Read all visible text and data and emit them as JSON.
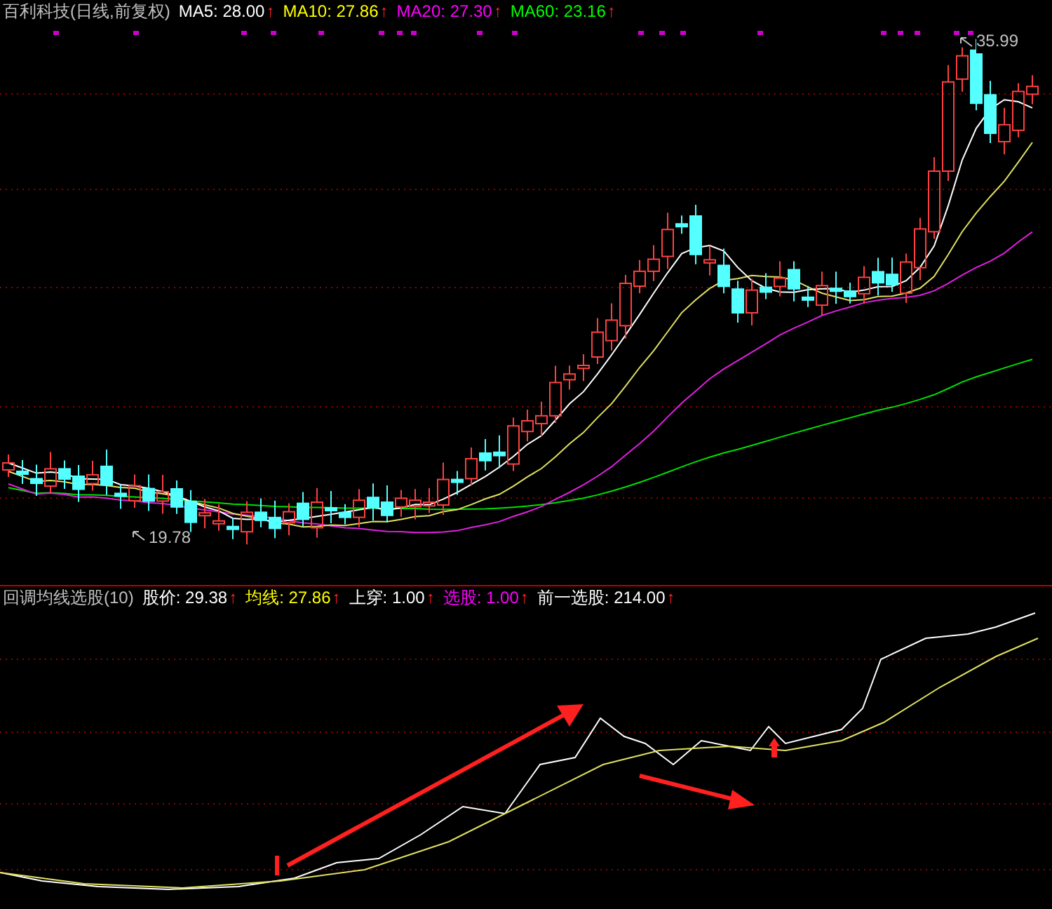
{
  "price_pane": {
    "title": "百利科技(日线,前复权)",
    "indicators": [
      {
        "label": "MA5:",
        "value": "28.00",
        "arrow": "↑",
        "color": "#ffffff"
      },
      {
        "label": "MA10:",
        "value": "27.86",
        "arrow": "↑",
        "color": "#ffff00"
      },
      {
        "label": "MA20:",
        "value": "27.30",
        "arrow": "↑",
        "color": "#ff00ff"
      },
      {
        "label": "MA60:",
        "value": "23.16",
        "arrow": "↑",
        "color": "#00ff00"
      }
    ],
    "high_label": "35.99",
    "low_label": "19.78"
  },
  "indicator_pane": {
    "title": "回调均线选股(10)",
    "indicators": [
      {
        "label": "股价:",
        "value": "29.38",
        "arrow": "↑",
        "color": "#ffffff"
      },
      {
        "label": "均线:",
        "value": "27.86",
        "arrow": "↑",
        "color": "#ffff00"
      },
      {
        "label": "上穿:",
        "value": "1.00",
        "arrow": "↑",
        "color": "#ffffff"
      },
      {
        "label": "选股:",
        "value": "1.00",
        "arrow": "↑",
        "color": "#ff00ff"
      },
      {
        "label": "前一选股:",
        "value": "214.00",
        "arrow": "↑",
        "color": "#ffffff"
      }
    ]
  }
}
